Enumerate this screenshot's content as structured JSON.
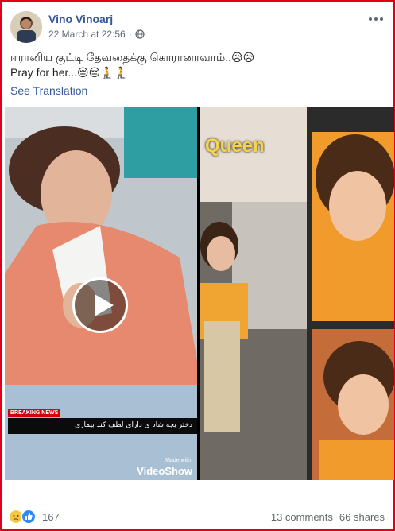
{
  "post": {
    "author": "Vino Vinoarj",
    "timestamp": "22 March at 22:56",
    "privacy_icon": "globe-icon",
    "text_line1": "ஈரானிய குட்டி தேவதைக்கு கொரானாவாம்..😥😥",
    "text_line2": "Pray for her...😔😔🧎🧎",
    "see_translation": "See Translation"
  },
  "media": {
    "left_video": {
      "badge": "BREAKING NEWS",
      "caption": "دختر بچه شاد ی دارای لطف کند بیماری",
      "watermark_small": "Made with",
      "watermark_big": "VideoShow"
    },
    "right_video": {
      "overlay_text": "Queen"
    }
  },
  "footer": {
    "reaction_icons": [
      "sad-reaction-icon",
      "like-reaction-icon"
    ],
    "reaction_count": "167",
    "comments": "13 comments",
    "shares": "66 shares"
  },
  "colors": {
    "frame_border": "#e0001b",
    "link_blue": "#365899",
    "meta_grey": "#606770"
  }
}
